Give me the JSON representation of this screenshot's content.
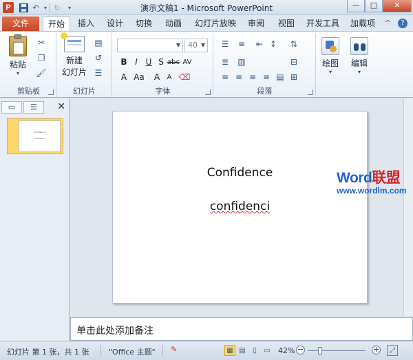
{
  "titlebar": {
    "app_icon": "P",
    "title": "演示文稿1 - Microsoft PowerPoint",
    "icons": [
      "save-icon",
      "undo-icon",
      "redo-icon",
      "customize-qat-icon"
    ]
  },
  "window_buttons": {
    "minimize": "—",
    "maximize": "□",
    "close": "✕"
  },
  "tabs": [
    {
      "label": "文件"
    },
    {
      "label": "开始"
    },
    {
      "label": "插入"
    },
    {
      "label": "设计"
    },
    {
      "label": "切换"
    },
    {
      "label": "动画"
    },
    {
      "label": "幻灯片放映"
    },
    {
      "label": "审阅"
    },
    {
      "label": "视图"
    },
    {
      "label": "开发工具"
    },
    {
      "label": "加载项"
    }
  ],
  "active_tab": "开始",
  "ribbon": {
    "clipboard": {
      "paste_label": "粘贴",
      "group_label": "剪贴板"
    },
    "slides": {
      "new_slide_line1": "新建",
      "new_slide_line2": "幻灯片",
      "group_label": "幻灯片"
    },
    "font": {
      "font_name": "",
      "font_size": "40",
      "group_label": "字体"
    },
    "paragraph": {
      "group_label": "段落"
    },
    "drawing": {
      "label": "绘图"
    },
    "editing": {
      "label": "编辑"
    }
  },
  "slide_pane": {
    "slide_number": "1",
    "thumb_line1": "Confidence",
    "thumb_line2": "confidenci"
  },
  "slide": {
    "line1": "Confidence",
    "line2": "confidenci"
  },
  "watermark": {
    "brand_a": "Word",
    "brand_b": "联盟",
    "url": "www.wordlm.com"
  },
  "notes": {
    "placeholder": "单击此处添加备注"
  },
  "status": {
    "slide_info": "幻灯片 第 1 张，共 1 张",
    "theme": "\"Office 主题\"",
    "zoom": "42%",
    "zoom_out": "−",
    "zoom_in": "+"
  },
  "colors": {
    "file_tab": "#c8472a",
    "accent": "#2463c5",
    "highlight": "#fbd86c"
  }
}
